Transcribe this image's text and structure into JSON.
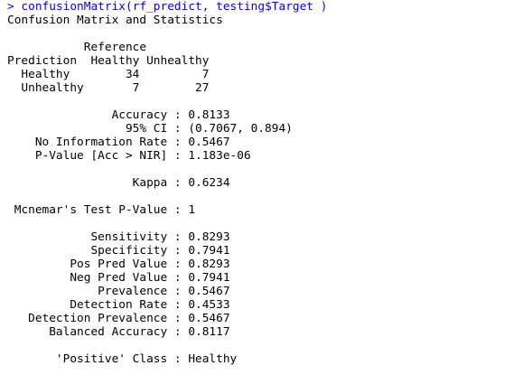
{
  "console": {
    "prompt": "> ",
    "command": "confusionMatrix(rf_predict, testing$Target )",
    "lines": [
      "Confusion Matrix and Statistics",
      "",
      "           Reference",
      "Prediction  Healthy Unhealthy",
      "  Healthy        34         7",
      "  Unhealthy       7        27",
      "",
      "               Accuracy : 0.8133",
      "                 95% CI : (0.7067, 0.894)",
      "    No Information Rate : 0.5467",
      "    P-Value [Acc > NIR] : 1.183e-06",
      "",
      "                  Kappa : 0.6234",
      "",
      " Mcnemar's Test P-Value : 1",
      "",
      "            Sensitivity : 0.8293",
      "            Specificity : 0.7941",
      "         Pos Pred Value : 0.8293",
      "         Neg Pred Value : 0.7941",
      "             Prevalence : 0.5467",
      "         Detection Rate : 0.4533",
      "   Detection Prevalence : 0.5467",
      "      Balanced Accuracy : 0.8117",
      "",
      "       'Positive' Class : Healthy"
    ]
  },
  "colors": {
    "command": "#0000ff",
    "output": "#000000",
    "background": "#ffffff"
  }
}
